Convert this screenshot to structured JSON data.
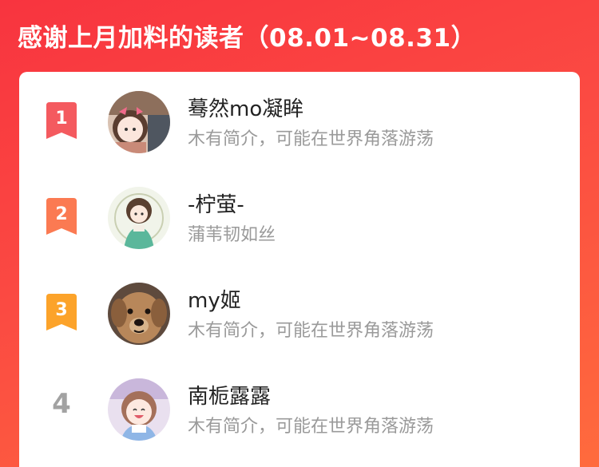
{
  "header": {
    "title": "感谢上月加料的读者（08.01~08.31）"
  },
  "colors": {
    "background_start": "#f8343f",
    "background_end": "#ff6b3d",
    "rank1": "#f45a5f",
    "rank2": "#fb7a52",
    "rank3": "#fca32a",
    "rank_plain": "#a2a2a2"
  },
  "readers": [
    {
      "rank": "1",
      "name": "蓦然mo凝眸",
      "description": "木有简介，可能在世界角落游荡",
      "avatar_icon": "avatar-girl-pink-bow"
    },
    {
      "rank": "2",
      "name": "-柠萤-",
      "description": "蒲苇韧如丝",
      "avatar_icon": "avatar-girl-green-dress"
    },
    {
      "rank": "3",
      "name": "my姬",
      "description": "木有简介，可能在世界角落游荡",
      "avatar_icon": "avatar-golden-retriever"
    },
    {
      "rank": "4",
      "name": "南栀露露",
      "description": "木有简介，可能在世界角落游荡",
      "avatar_icon": "avatar-laughing-girl"
    }
  ]
}
